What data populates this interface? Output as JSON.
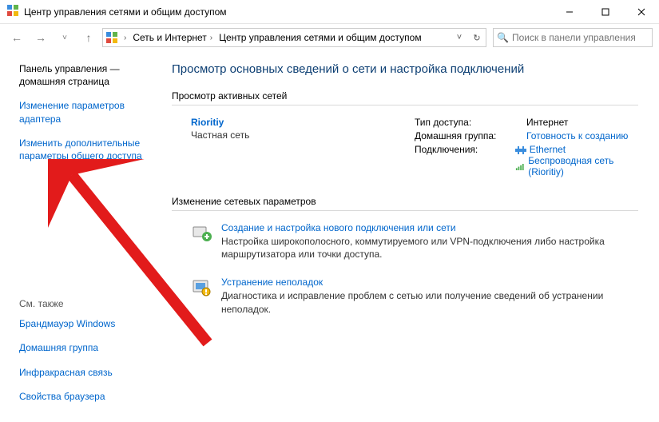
{
  "window": {
    "title": "Центр управления сетями и общим доступом"
  },
  "breadcrumb": {
    "root": "Сеть и Интернет",
    "current": "Центр управления сетями и общим доступом"
  },
  "search": {
    "placeholder": "Поиск в панели управления"
  },
  "sidebar": {
    "home": "Панель управления — домашняя страница",
    "links": [
      "Изменение параметров адаптера",
      "Изменить дополнительные параметры общего доступа"
    ],
    "see_also_h": "См. также",
    "see_also": [
      "Брандмауэр Windows",
      "Домашняя группа",
      "Инфракрасная связь",
      "Свойства браузера"
    ]
  },
  "main": {
    "heading": "Просмотр основных сведений о сети и настройка подключений",
    "active_h": "Просмотр активных сетей",
    "network": {
      "name": "Rioritiy",
      "type": "Частная сеть",
      "access_label": "Тип доступа:",
      "access_value": "Интернет",
      "homegroup_label": "Домашняя группа:",
      "homegroup_value": "Готовность к созданию",
      "conn_label": "Подключения:",
      "conn_eth": "Ethernet",
      "conn_wifi": "Беспроводная сеть (Rioritiy)"
    },
    "change_h": "Изменение сетевых параметров",
    "tasks": [
      {
        "title": "Создание и настройка нового подключения или сети",
        "desc": "Настройка широкополосного, коммутируемого или VPN-подключения либо настройка маршрутизатора или точки доступа."
      },
      {
        "title": "Устранение неполадок",
        "desc": "Диагностика и исправление проблем с сетью или получение сведений об устранении неполадок."
      }
    ]
  }
}
